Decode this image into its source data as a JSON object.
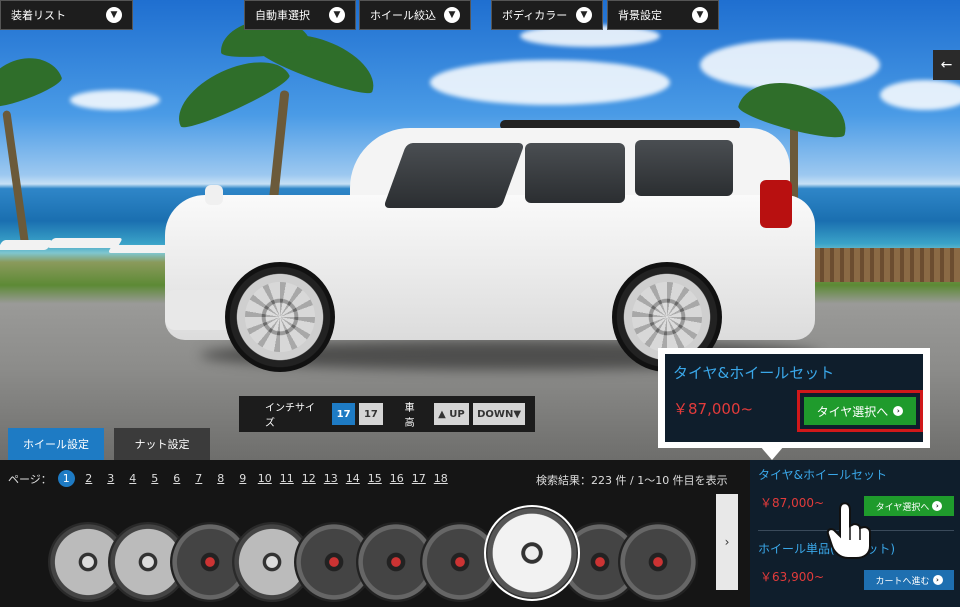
{
  "top_menu": [
    {
      "label": "装着リスト"
    },
    {
      "label": "自動車選択"
    },
    {
      "label": "ホイール絞込"
    },
    {
      "label": "ボディカラー"
    },
    {
      "label": "背景設定"
    }
  ],
  "back_icon": "arrow-left-icon",
  "size_bar": {
    "inch_label": "インチサイズ",
    "inch_active": "17",
    "inch_other": "17",
    "height_label": "車高",
    "up_label": "UP",
    "down_label": "DOWN"
  },
  "tabs": [
    {
      "label": "ホイール設定",
      "active": true
    },
    {
      "label": "ナット設定",
      "active": false
    }
  ],
  "pager": {
    "label": "ページ：",
    "pages": [
      "1",
      "2",
      "3",
      "4",
      "5",
      "6",
      "7",
      "8",
      "9",
      "10",
      "11",
      "12",
      "13",
      "14",
      "15",
      "16",
      "17",
      "18"
    ],
    "current": "1"
  },
  "results": {
    "text": "検索結果：223 件 / 1〜10 件目を表示"
  },
  "strip_next": "›",
  "callout": {
    "title": "タイヤ&ホイールセット",
    "price": "￥87,000~",
    "button": "タイヤ選択へ"
  },
  "right_panel": {
    "set_title": "タイヤ&ホイールセット",
    "set_price": "￥87,000~",
    "set_button": "タイヤ選択へ",
    "single_title": "ホイール単品(4本セット)",
    "single_price": "￥63,900~",
    "cart_button": "カートへ進む"
  },
  "colors": {
    "accent_blue": "#1e7bc4",
    "price_red": "#e23b3b",
    "title_blue": "#3aa7e8",
    "button_green": "#1f9b2c",
    "highlight_red": "#d0181a"
  }
}
